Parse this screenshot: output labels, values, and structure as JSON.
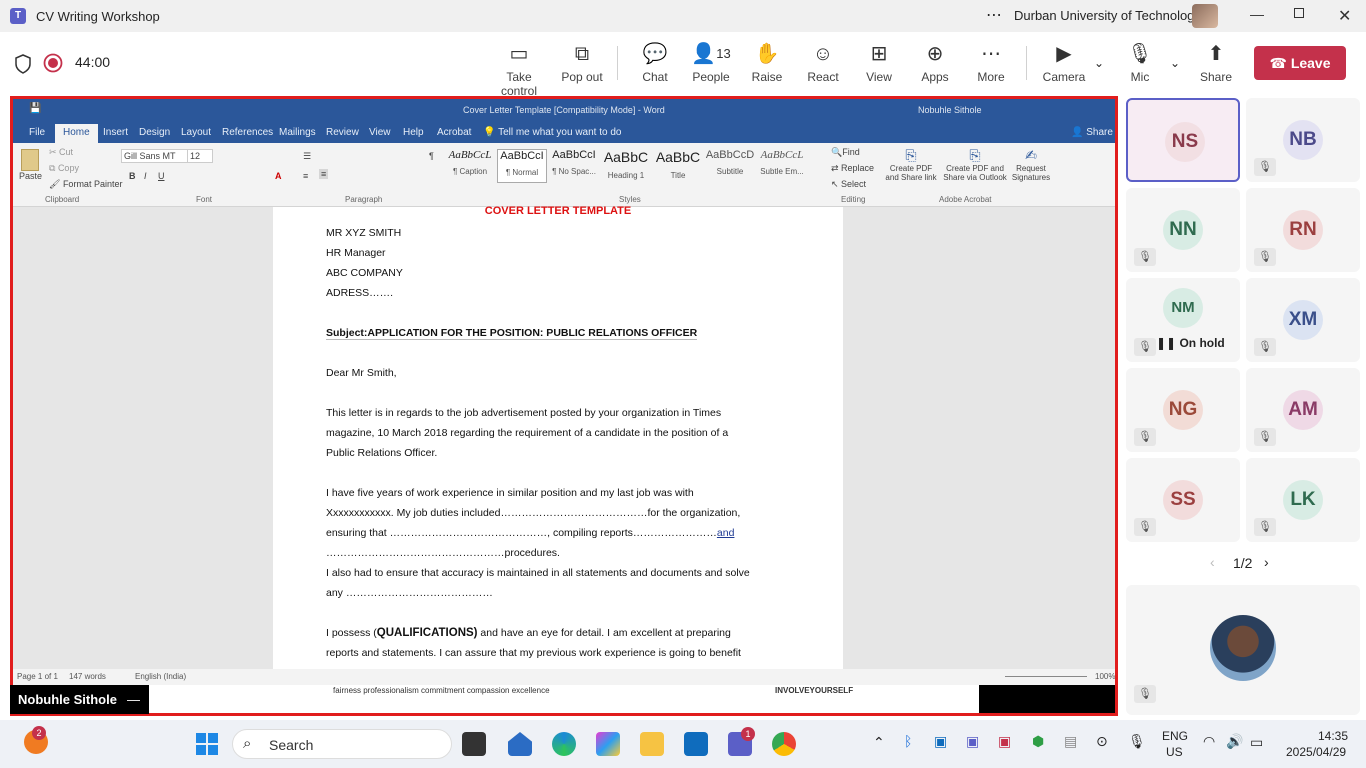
{
  "window": {
    "title": "CV Writing Workshop",
    "organization": "Durban University of Technology",
    "more_label": "⋯"
  },
  "meeting": {
    "timer": "44:00",
    "toolbar": {
      "take_control": "Take control",
      "pop_out": "Pop out",
      "chat": "Chat",
      "people": "People",
      "people_count": "13",
      "raise": "Raise",
      "react": "React",
      "view": "View",
      "apps": "Apps",
      "more": "More",
      "camera": "Camera",
      "mic": "Mic",
      "share": "Share",
      "leave": "Leave"
    }
  },
  "word": {
    "title": "Cover Letter Template [Compatibility Mode]  -  Word",
    "user": "Nobuhle Sithole",
    "tabs": [
      "File",
      "Home",
      "Insert",
      "Design",
      "Layout",
      "References",
      "Mailings",
      "Review",
      "View",
      "Help",
      "Acrobat"
    ],
    "tell_me": "Tell me what you want to do",
    "share": "Share",
    "ribbon": {
      "cut": "Cut",
      "copy": "Copy",
      "format_painter": "Format Painter",
      "paste": "Paste",
      "clipboard": "Clipboard",
      "font_name": "Gill Sans MT",
      "font_size": "12",
      "font": "Font",
      "paragraph": "Paragraph",
      "styles_label": "Styles",
      "styles": [
        {
          "sample": "AaBbCcL",
          "name": "¶ Caption"
        },
        {
          "sample": "AaBbCcI",
          "name": "¶ Normal"
        },
        {
          "sample": "AaBbCcI",
          "name": "¶ No Spac..."
        },
        {
          "sample": "AaBbC",
          "name": "Heading 1"
        },
        {
          "sample": "AaBbC",
          "name": "Title"
        },
        {
          "sample": "AaBbCcD",
          "name": "Subtitle"
        },
        {
          "sample": "AaBbCcL",
          "name": "Subtle Em..."
        }
      ],
      "find": "Find",
      "replace": "Replace",
      "select": "Select",
      "editing": "Editing",
      "create_pdf": "Create PDF and Share link",
      "create_pdf_outlook": "Create PDF and Share via Outlook",
      "request_signatures": "Request Signatures",
      "adobe_acrobat": "Adobe Acrobat"
    },
    "document": {
      "heading": "COVER LETTER TEMPLATE",
      "lines": [
        "MR XYZ SMITH",
        "HR Manager",
        "ABC COMPANY",
        "ADRESS……."
      ],
      "subject_label": "Subject:",
      "subject_text": "APPLICATION FOR THE POSITION: PUBLIC RELATIONS OFFICER",
      "salutation": "Dear Mr Smith,",
      "para1_l1": "This letter is in regards to the job advertisement posted by your organization in Times",
      "para1_l2": "magazine, 10 March 2018 regarding the requirement of a candidate in the position of a",
      "para1_l3": "Public Relations Officer.",
      "para2_l1": "I have five years of work experience in similar position and my last job was with",
      "para2_l2": "Xxxxxxxxxxxx. My job duties included……………………………………for the organization,",
      "para2_l3a": "ensuring that ………………………………………, compiling reports……………………",
      "para2_l3b": "and",
      "para2_l4": "……………………………………………procedures.",
      "para3_l1": "I also had to ensure that accuracy is maintained in all statements and documents and solve",
      "para3_l2": "any ……………………………………",
      "para4_l1a": "I possess (",
      "para4_l1b": "QUALIFICATIONS)",
      "para4_l1c": " and have an eye for detail. I am excellent at preparing",
      "para4_l2": "reports and statements. I can assure that my previous work experience is going to benefit"
    },
    "status": {
      "page": "Page 1 of 1",
      "words": "147 words",
      "language": "English (India)",
      "zoom": "100%"
    },
    "footer_strip": "fairness   professionalism   commitment   compassion   excellence",
    "footer_strip2": "INVOLVEYOURSELF"
  },
  "presenter_name": "Nobuhle Sithole",
  "participants": [
    {
      "initials": "NS",
      "bg": "#f2dfe3",
      "fg": "#8a3a4b",
      "muted": false,
      "active": true
    },
    {
      "initials": "NB",
      "bg": "#e3e2f2",
      "fg": "#4c4a8a",
      "muted": true
    },
    {
      "initials": "NN",
      "bg": "#d8ece4",
      "fg": "#2f6b4f",
      "muted": true
    },
    {
      "initials": "RN",
      "bg": "#f2dcdc",
      "fg": "#9b3f3f",
      "muted": true
    },
    {
      "initials": "NM",
      "bg": "#d8ece4",
      "fg": "#2f6b4f",
      "muted": true,
      "status": "On hold"
    },
    {
      "initials": "XM",
      "bg": "#dbe3f2",
      "fg": "#3a4f8a",
      "muted": true
    },
    {
      "initials": "NG",
      "bg": "#f2dcd6",
      "fg": "#9b4a3a",
      "muted": true
    },
    {
      "initials": "AM",
      "bg": "#efd9e6",
      "fg": "#8a3a66",
      "muted": true
    },
    {
      "initials": "SS",
      "bg": "#f2dcdc",
      "fg": "#9b3f3f",
      "muted": true
    },
    {
      "initials": "LK",
      "bg": "#d8ece4",
      "fg": "#2f6b4f",
      "muted": true
    }
  ],
  "pager": "1/2",
  "taskbar": {
    "search_placeholder": "Search",
    "notification_count": "2",
    "teams_badge": "1",
    "lang_primary": "ENG",
    "lang_secondary": "US",
    "time": "14:35",
    "date": "2025/04/29"
  }
}
